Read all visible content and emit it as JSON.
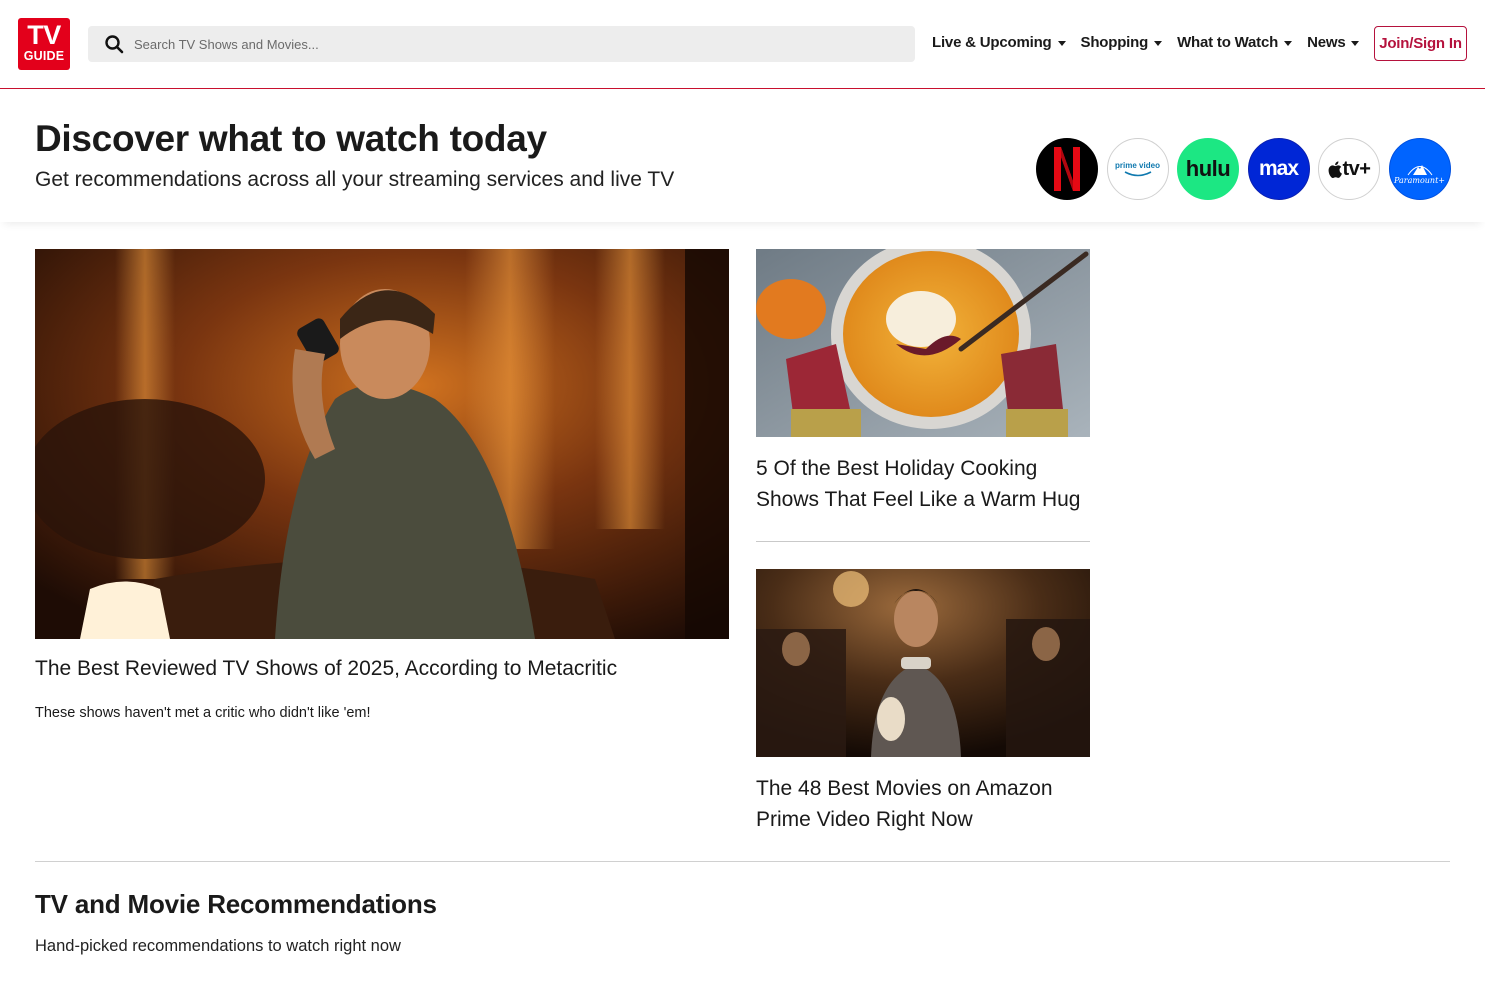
{
  "header": {
    "logo": {
      "line1": "TV",
      "line2": "GUIDE"
    },
    "search": {
      "placeholder": "Search TV Shows and Movies..."
    },
    "nav": [
      {
        "label": "Live & Upcoming"
      },
      {
        "label": "Shopping"
      },
      {
        "label": "What to Watch"
      },
      {
        "label": "News"
      }
    ],
    "join_label": "Join/Sign In"
  },
  "discover": {
    "title": "Discover what to watch today",
    "subtitle": "Get recommendations across all your streaming services and live TV",
    "services": [
      {
        "name": "netflix",
        "text": "N"
      },
      {
        "name": "prime-video",
        "text": "prime video"
      },
      {
        "name": "hulu",
        "text": "hulu"
      },
      {
        "name": "max",
        "text": "max"
      },
      {
        "name": "apple-tv-plus",
        "text": "tv+"
      },
      {
        "name": "paramount-plus",
        "text": "Paramount+"
      }
    ]
  },
  "articles": {
    "hero": {
      "title": "The Best Reviewed TV Shows of 2025, According to Metacritic",
      "description": "These shows haven't met a critic who didn't like 'em!"
    },
    "side": [
      {
        "title": "5 Of the Best Holiday Cooking Shows That Feel Like a Warm Hug"
      },
      {
        "title": "The 48 Best Movies on Amazon Prime Video Right Now"
      }
    ]
  },
  "recommendations": {
    "title": "TV and Movie Recommendations",
    "subtitle": "Hand-picked recommendations to watch right now"
  },
  "colors": {
    "brand_red": "#e3001b",
    "accent_crimson": "#b5123d",
    "search_bg": "#ededed"
  }
}
